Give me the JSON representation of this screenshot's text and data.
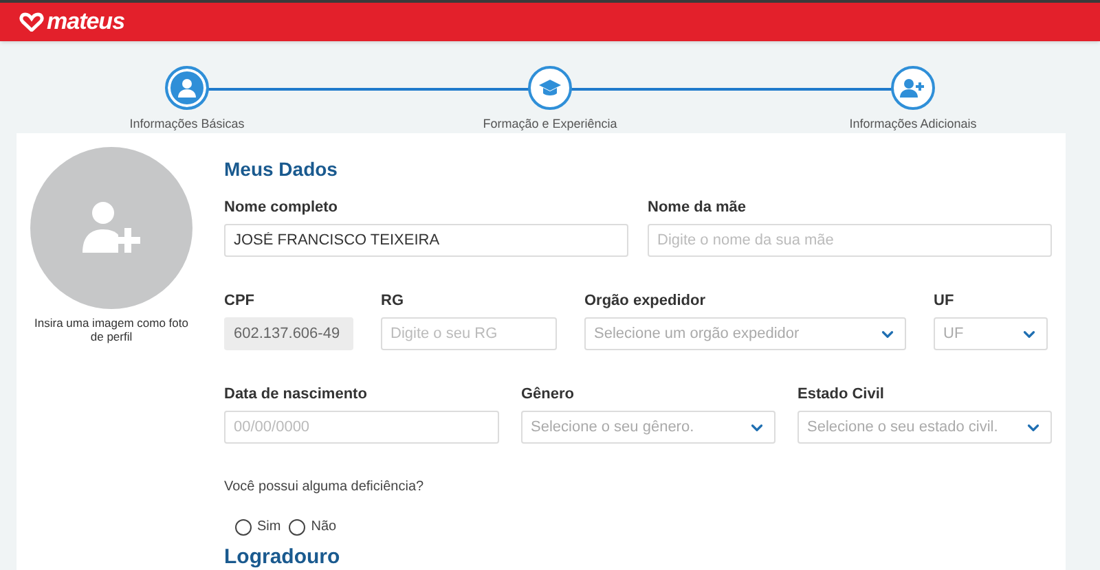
{
  "header": {
    "logo": "mateus"
  },
  "steps": [
    {
      "label": "Informações Básicas",
      "kind": "user",
      "selected": true
    },
    {
      "label": "Formação e Experiência",
      "kind": "graduation",
      "selected": false
    },
    {
      "label": "Informações Adicionais",
      "kind": "user-plus",
      "selected": false
    }
  ],
  "avatar": {
    "caption": "Insira uma imagem como foto de perfil"
  },
  "section_title": "Meus Dados",
  "rows": [
    [
      {
        "label": "Nome completo",
        "kind": "text",
        "value": "JOSÉ FRANCISCO TEIXEIRA",
        "disabled": false
      },
      {
        "label": "Nome da mãe",
        "kind": "text",
        "placeholder": "Digite o nome da sua mãe",
        "disabled": false
      }
    ],
    [
      {
        "label": "CPF",
        "kind": "text",
        "value": "602.137.606-49",
        "disabled": true
      },
      {
        "label": "RG",
        "kind": "text",
        "placeholder": "Digite o seu RG",
        "disabled": false
      },
      {
        "label": "Orgão expedidor",
        "kind": "select",
        "placeholder": "Selecione um orgão expedidor",
        "disabled": false
      },
      {
        "label": "UF",
        "kind": "select",
        "placeholder": "UF",
        "disabled": false
      }
    ],
    [
      {
        "label": "Data de nascimento",
        "kind": "text",
        "placeholder": "00/00/0000",
        "disabled": false
      },
      {
        "label": "Gênero",
        "kind": "select",
        "placeholder": "Selecione o seu gênero.",
        "disabled": false
      },
      {
        "label": "Estado Civil",
        "kind": "select",
        "placeholder": "Selecione o seu estado civil.",
        "disabled": false
      }
    ]
  ],
  "question": "Você possui alguma deficiência?",
  "options": [
    {
      "label": "Sim",
      "selected": false
    },
    {
      "label": "Não",
      "selected": false
    }
  ],
  "next_section_title": "Logradouro"
}
